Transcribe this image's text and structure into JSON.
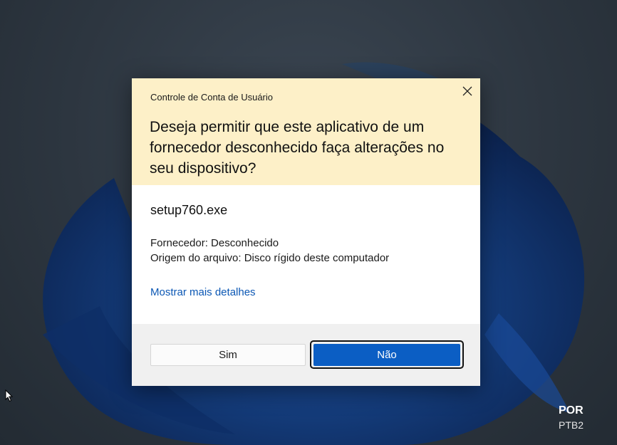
{
  "dialog": {
    "small_title": "Controle de Conta de Usuário",
    "question": "Deseja permitir que este aplicativo de um fornecedor desconhecido faça alterações no seu dispositivo?",
    "app_name": "setup760.exe",
    "publisher": "Fornecedor: Desconhecido",
    "origin": "Origem do arquivo: Disco rígido deste computador",
    "more_details": "Mostrar mais detalhes",
    "yes_label": "Sim",
    "no_label": "Não",
    "close_icon": "close-icon",
    "header_color": "#fdf0c8",
    "primary_color": "#0b5ec4"
  },
  "taskbar": {
    "language": "POR",
    "keyboard_layout": "PTB2"
  }
}
